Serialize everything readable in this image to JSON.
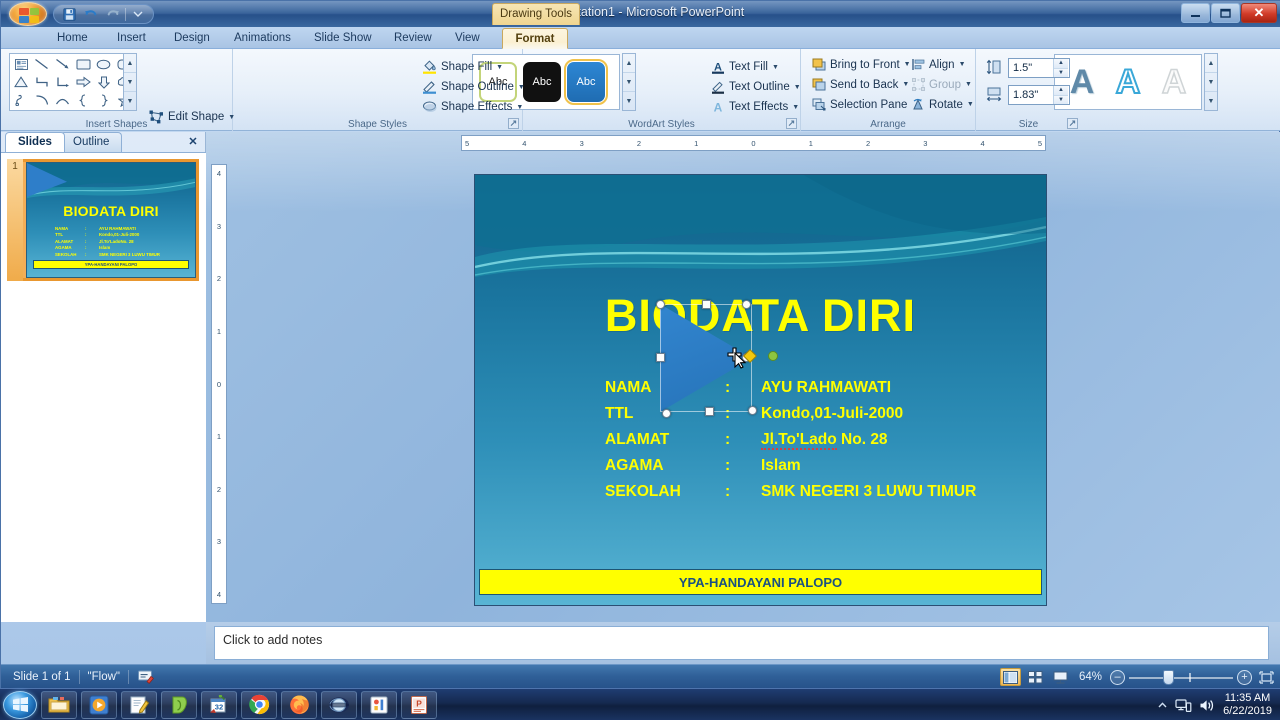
{
  "window": {
    "title": "Presentation1 - Microsoft PowerPoint",
    "contextual_tab_label": "Drawing Tools",
    "minimize": "–",
    "maximize": "❐",
    "close": "✕"
  },
  "quick_access": {
    "office_button": "office-orb",
    "items": [
      {
        "name": "save-icon",
        "label": "Save"
      },
      {
        "name": "undo-icon",
        "label": "Undo"
      },
      {
        "name": "redo-icon",
        "label": "Redo"
      },
      {
        "name": "customize-icon",
        "label": "Customize Quick Access Toolbar"
      }
    ]
  },
  "tabs": [
    {
      "label": "Home",
      "active": false
    },
    {
      "label": "Insert",
      "active": false
    },
    {
      "label": "Design",
      "active": false
    },
    {
      "label": "Animations",
      "active": false
    },
    {
      "label": "Slide Show",
      "active": false
    },
    {
      "label": "Review",
      "active": false
    },
    {
      "label": "View",
      "active": false
    },
    {
      "label": "Format",
      "active": true
    }
  ],
  "ribbon": {
    "groups": [
      {
        "title": "Insert Shapes"
      },
      {
        "title": "Shape Styles"
      },
      {
        "title": "WordArt Styles"
      },
      {
        "title": "Arrange"
      },
      {
        "title": "Size"
      }
    ],
    "insert_shapes": {
      "edit_shape": "Edit Shape",
      "text_box": "Text Box",
      "shape_glyphs": [
        "A",
        "\\",
        "↘",
        "▭",
        "◯",
        "▢",
        "△",
        "⌐",
        "⌐",
        "⇨",
        "⇩",
        "◠",
        "⌇",
        "⌒",
        "︵",
        "{",
        "}",
        "☆"
      ]
    },
    "shape_styles": {
      "thumbs": [
        "Abc",
        "Abc",
        "Abc"
      ],
      "shape_fill": "Shape Fill",
      "shape_outline": "Shape Outline",
      "shape_effects": "Shape Effects"
    },
    "wordart_styles": {
      "thumbs": [
        "A",
        "A",
        "A"
      ],
      "text_fill": "Text Fill",
      "text_outline": "Text Outline",
      "text_effects": "Text Effects"
    },
    "arrange": {
      "bring_to_front": "Bring to Front",
      "send_to_back": "Send to Back",
      "selection_pane": "Selection Pane",
      "align": "Align",
      "group": "Group",
      "rotate": "Rotate"
    },
    "size": {
      "height_value": "1.5\"",
      "width_value": "1.83\"",
      "height_placeholder": "Height",
      "width_placeholder": "Width"
    }
  },
  "left_pane": {
    "tab_slides": "Slides",
    "tab_outline": "Outline",
    "close": "✕",
    "slide_number": "1"
  },
  "rulers": {
    "horizontal": [
      "5",
      "4",
      "3",
      "2",
      "1",
      "0",
      "1",
      "2",
      "3",
      "4",
      "5"
    ],
    "vertical": [
      "4",
      "3",
      "2",
      "1",
      "0",
      "1",
      "2",
      "3",
      "4"
    ]
  },
  "slide": {
    "title": "BIODATA DIRI",
    "rows": [
      {
        "key": "NAMA",
        "colon": ":",
        "value": "AYU RAHMAWATI",
        "underline": false
      },
      {
        "key": "TTL",
        "colon": ":",
        "value": "Kondo,01-Juli-2000",
        "underline": false
      },
      {
        "key": "ALAMAT",
        "colon": ":",
        "value_underlined": "Jl.To'Lado",
        "value": " No. 28",
        "underline": true
      },
      {
        "key": "AGAMA",
        "colon": ":",
        "value": "Islam",
        "underline": false
      },
      {
        "key": "SEKOLAH",
        "colon": ":",
        "value": "SMK NEGERI 3 LUWU TIMUR",
        "underline": false
      }
    ],
    "footer": "YPA-HANDAYANI PALOPO",
    "title_color": "#ffff00",
    "footer_bg": "#ffff00",
    "footer_color": "#1a5182"
  },
  "notes": {
    "placeholder_text": "Click to add notes"
  },
  "status_bar": {
    "slide_indicator": "Slide 1 of 1",
    "theme_name": "\"Flow\"",
    "spellcheck_icon": "spellcheck-icon",
    "zoom_level": "64%",
    "zoom_out": "–",
    "zoom_in": "+",
    "views": [
      {
        "name": "normal-view",
        "active": true
      },
      {
        "name": "slide-sorter-view",
        "active": false
      },
      {
        "name": "slide-show-view",
        "active": false
      }
    ],
    "fit_to_window": "fit-window-icon"
  },
  "taskbar": {
    "start": "start-orb",
    "items": [
      "file-explorer-icon",
      "media-player-icon",
      "notepad-icon",
      "green-app-icon",
      "calendar-32-icon",
      "google-chrome-icon",
      "mozilla-firefox-icon",
      "media-globe-icon",
      "photo-viewer-icon",
      "powerpoint-icon"
    ],
    "tray": {
      "show_hidden": "▲",
      "network_icon": "network-icon",
      "volume_icon": "volume-icon",
      "time": "11:35 AM",
      "date": "6/22/2019"
    }
  },
  "selection": {
    "shape": "triangle",
    "handles": [
      "corner",
      "edge",
      "adjustment",
      "rotation"
    ],
    "cursor": "move-cursor"
  }
}
